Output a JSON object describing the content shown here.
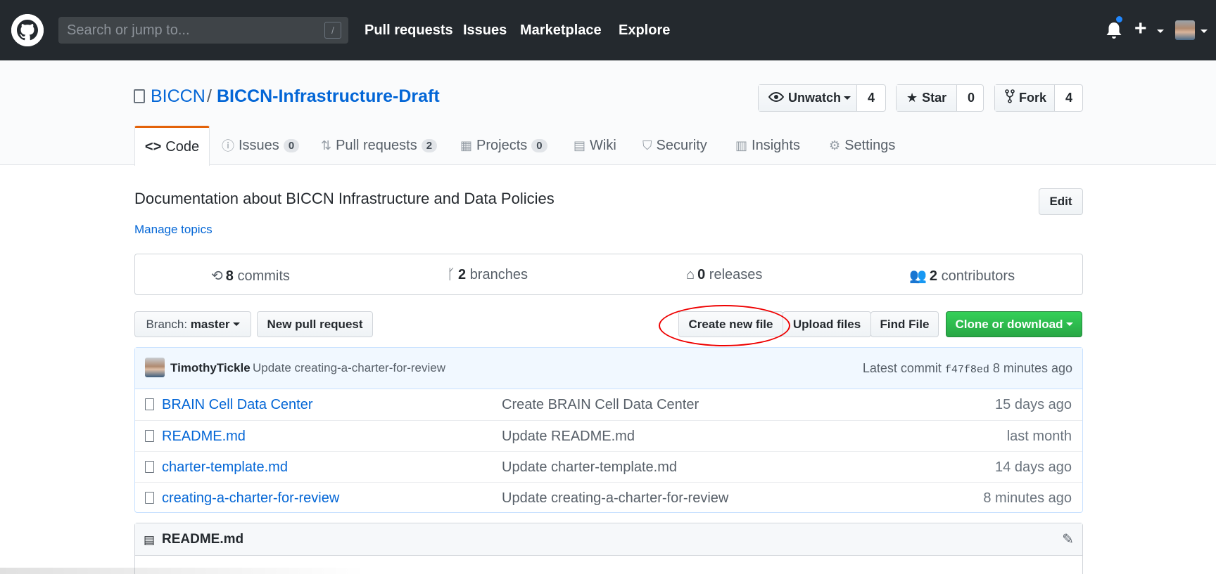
{
  "header": {
    "search_placeholder": "Search or jump to...",
    "search_shortcut": "/",
    "nav": [
      "Pull requests",
      "Issues",
      "Marketplace",
      "Explore"
    ]
  },
  "repo": {
    "owner": "BICCN",
    "separator": "/",
    "name": "BICCN-Infrastructure-Draft",
    "watch": {
      "label": "Unwatch",
      "count": "4"
    },
    "star": {
      "label": "Star",
      "count": "0"
    },
    "fork": {
      "label": "Fork",
      "count": "4"
    }
  },
  "tabs": [
    {
      "label": "Code",
      "icon": "code-icon"
    },
    {
      "label": "Issues",
      "counter": "0",
      "icon": "issue-icon"
    },
    {
      "label": "Pull requests",
      "counter": "2",
      "icon": "pull-request-icon"
    },
    {
      "label": "Projects",
      "counter": "0",
      "icon": "project-icon"
    },
    {
      "label": "Wiki",
      "icon": "book-icon"
    },
    {
      "label": "Security",
      "icon": "shield-icon"
    },
    {
      "label": "Insights",
      "icon": "graph-icon"
    },
    {
      "label": "Settings",
      "icon": "gear-icon"
    }
  ],
  "about": {
    "description": "Documentation about BICCN Infrastructure and Data Policies",
    "manage_topics": "Manage topics",
    "edit": "Edit"
  },
  "summary": {
    "commits": {
      "count": "8",
      "label": "commits"
    },
    "branches": {
      "count": "2",
      "label": "branches"
    },
    "releases": {
      "count": "0",
      "label": "releases"
    },
    "contributors": {
      "count": "2",
      "label": "contributors"
    }
  },
  "toolbar": {
    "branch_label": "Branch:",
    "branch_value": "master",
    "new_pull_request": "New pull request",
    "create_new_file": "Create new file",
    "upload_files": "Upload files",
    "find_file": "Find File",
    "clone_or_download": "Clone or download"
  },
  "latest_commit": {
    "author": "TimothyTickle",
    "message": "Update creating-a-charter-for-review",
    "prefix": "Latest commit",
    "sha": "f47f8ed",
    "age": "8 minutes ago"
  },
  "files": [
    {
      "name": "BRAIN Cell Data Center",
      "message": "Create BRAIN Cell Data Center",
      "age": "15 days ago"
    },
    {
      "name": "README.md",
      "message": "Update README.md",
      "age": "last month"
    },
    {
      "name": "charter-template.md",
      "message": "Update charter-template.md",
      "age": "14 days ago"
    },
    {
      "name": "creating-a-charter-for-review",
      "message": "Update creating-a-charter-for-review",
      "age": "8 minutes ago"
    }
  ],
  "readme": {
    "title": "README.md"
  },
  "colors": {
    "accent": "#0366d6",
    "header_bg": "#24292e",
    "active_tab": "#e36209",
    "green": "#28a745",
    "annotation": "#ee0000"
  }
}
